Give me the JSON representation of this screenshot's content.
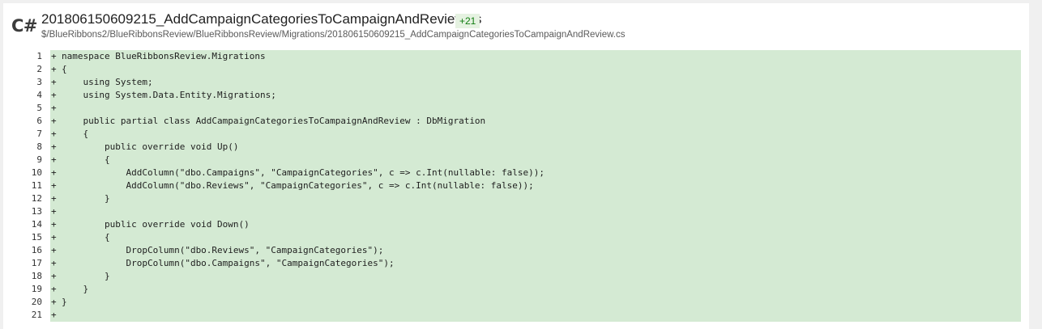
{
  "file": {
    "language_label": "C#",
    "title": "201806150609215_AddCampaignCategoriesToCampaignAndReview.cs",
    "change_count": "+21",
    "path": "$/BlueRibbons2/BlueRibbonsReview/BlueRibbonsReview/Migrations/201806150609215_AddCampaignCategoriesToCampaignAndReview.cs"
  },
  "colors": {
    "added_line_background": "#d4ead3",
    "badge_background": "#e5f2e1",
    "badge_text": "#107c10"
  },
  "diff": {
    "lines": [
      {
        "number": "1",
        "marker": "+",
        "text": "namespace BlueRibbonsReview.Migrations"
      },
      {
        "number": "2",
        "marker": "+",
        "text": "{"
      },
      {
        "number": "3",
        "marker": "+",
        "text": "    using System;"
      },
      {
        "number": "4",
        "marker": "+",
        "text": "    using System.Data.Entity.Migrations;"
      },
      {
        "number": "5",
        "marker": "+",
        "text": ""
      },
      {
        "number": "6",
        "marker": "+",
        "text": "    public partial class AddCampaignCategoriesToCampaignAndReview : DbMigration"
      },
      {
        "number": "7",
        "marker": "+",
        "text": "    {"
      },
      {
        "number": "8",
        "marker": "+",
        "text": "        public override void Up()"
      },
      {
        "number": "9",
        "marker": "+",
        "text": "        {"
      },
      {
        "number": "10",
        "marker": "+",
        "text": "            AddColumn(\"dbo.Campaigns\", \"CampaignCategories\", c => c.Int(nullable: false));"
      },
      {
        "number": "11",
        "marker": "+",
        "text": "            AddColumn(\"dbo.Reviews\", \"CampaignCategories\", c => c.Int(nullable: false));"
      },
      {
        "number": "12",
        "marker": "+",
        "text": "        }"
      },
      {
        "number": "13",
        "marker": "+",
        "text": ""
      },
      {
        "number": "14",
        "marker": "+",
        "text": "        public override void Down()"
      },
      {
        "number": "15",
        "marker": "+",
        "text": "        {"
      },
      {
        "number": "16",
        "marker": "+",
        "text": "            DropColumn(\"dbo.Reviews\", \"CampaignCategories\");"
      },
      {
        "number": "17",
        "marker": "+",
        "text": "            DropColumn(\"dbo.Campaigns\", \"CampaignCategories\");"
      },
      {
        "number": "18",
        "marker": "+",
        "text": "        }"
      },
      {
        "number": "19",
        "marker": "+",
        "text": "    }"
      },
      {
        "number": "20",
        "marker": "+",
        "text": "}"
      },
      {
        "number": "21",
        "marker": "+",
        "text": ""
      }
    ]
  }
}
